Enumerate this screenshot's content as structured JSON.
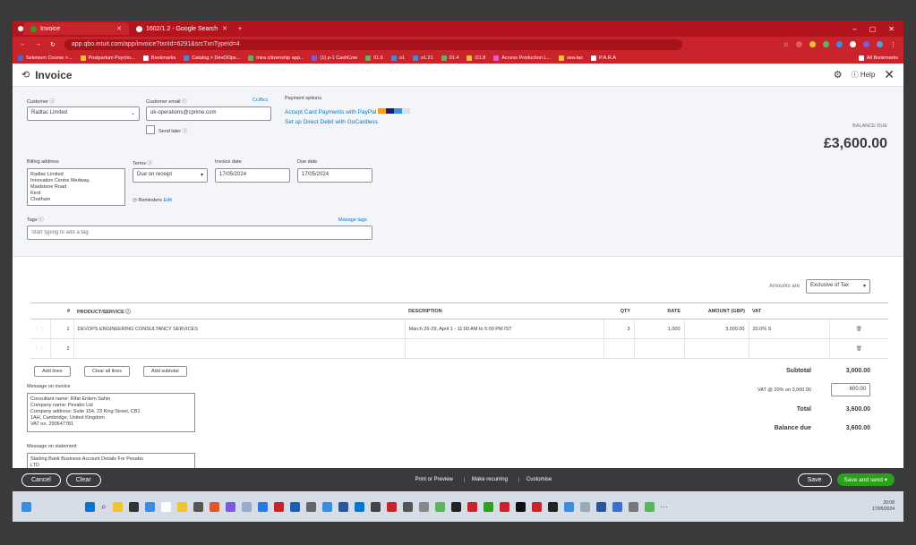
{
  "browser": {
    "tabs": [
      {
        "label": "Invoice",
        "active": true
      },
      {
        "label": "1602/1.2 - Google Search",
        "active": false
      }
    ],
    "url": "app.qbo.intuit.com/app/invoice?txnId=6291&srcTxnTypeId=4",
    "bookmarks": [
      "Selenium Course >...",
      "Postpartum Psycho...",
      "Bookmarks",
      "Catalog > DevOOps...",
      "mira citizenship app...",
      "(1) p-1 CashCow",
      "01.6",
      "o1",
      "o1.21",
      "01.4",
      "O1.8",
      "Access Production L...",
      "sea-tac",
      "P.A.R.A",
      "All Bookmarks"
    ]
  },
  "header": {
    "title": "Invoice",
    "help": "Help"
  },
  "customer": {
    "label": "Customer",
    "value": "Radtac Limited",
    "email_label": "Customer email",
    "email": "uk-operations@cprime.com",
    "ccbcc": "Cc/Bcc",
    "send_later": "Send later"
  },
  "payment": {
    "label": "Payment options",
    "card": "Accept Card Payments with PayPal",
    "direct_debit": "Set up Direct Debit with GoCardless"
  },
  "balance": {
    "label": "BALANCE DUE",
    "value": "£3,600.00"
  },
  "billing": {
    "label": "Billing address",
    "lines": "Radtac Limited\nInnovation Centre Medway,\nMaidstone Road\nKent\nChatham"
  },
  "terms": {
    "label": "Terms",
    "value": "Due on receipt"
  },
  "invoice_date": {
    "label": "Invoice date",
    "value": "17/05/2024"
  },
  "due_date": {
    "label": "Due date",
    "value": "17/05/2024"
  },
  "reminders": {
    "label": "Reminders",
    "edit": "Edit"
  },
  "tags": {
    "label": "Tags",
    "manage": "Manage tags",
    "placeholder": "Start typing to add a tag"
  },
  "amounts": {
    "label": "Amounts are",
    "value": "Exclusive of Tax"
  },
  "table": {
    "headers": [
      "#",
      "PRODUCT/SERVICE",
      "DESCRIPTION",
      "QTY",
      "RATE",
      "AMOUNT (GBP)",
      "VAT"
    ],
    "rows": [
      {
        "n": "1",
        "product": "DEVOPS ENGINEERING CONSULTANCY SERVICES",
        "desc": "March 26-29, April 1 - 11:00 AM to 5:00 PM IST",
        "qty": "3",
        "rate": "1,000",
        "amount": "3,000.00",
        "vat": "20.0% S"
      },
      {
        "n": "2",
        "product": "",
        "desc": "",
        "qty": "",
        "rate": "",
        "amount": "",
        "vat": ""
      }
    ]
  },
  "line_buttons": {
    "add": "Add lines",
    "clear": "Clear all lines",
    "subtotal": "Add subtotal"
  },
  "totals": {
    "subtotal_label": "Subtotal",
    "subtotal": "3,000.00",
    "vat_label": "VAT @ 20% on 3,000.00",
    "vat": "600.00",
    "total_label": "Total",
    "total": "3,600.00",
    "balance_label": "Balance due",
    "balance": "3,600.00"
  },
  "message": {
    "label": "Message on invoice",
    "text": "Consultant name: Rifat Erdem Sahin\nCompany name: Pesabo Ltd\nCompany address: Suite 154, 23 King Street, CB1\n1AH, Cambridge, United Kingdom\nVAT no. 290647781"
  },
  "statement": {
    "label": "Message on statement",
    "text": "Starling Bank Business Account Details For Pesabo\nLTD"
  },
  "footer": {
    "cancel": "Cancel",
    "clear": "Clear",
    "print": "Print or Preview",
    "recurring": "Make recurring",
    "customise": "Customise",
    "save": "Save",
    "save_send": "Save and send"
  },
  "taskbar": {
    "time": "20:08",
    "date": "17/05/2024"
  }
}
